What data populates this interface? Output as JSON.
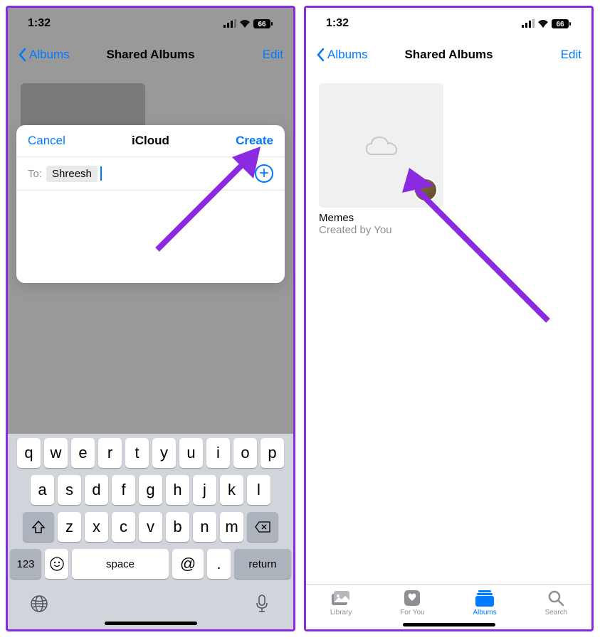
{
  "status": {
    "time": "1:32",
    "battery": "66"
  },
  "nav": {
    "back": "Albums",
    "title": "Shared Albums",
    "edit": "Edit"
  },
  "modal": {
    "cancel": "Cancel",
    "title": "iCloud",
    "create": "Create",
    "to_label": "To:",
    "to_value": "Shreesh"
  },
  "album": {
    "name": "Memes",
    "subtitle": "Created by You"
  },
  "tabs": {
    "library": "Library",
    "foryou": "For You",
    "albums": "Albums",
    "search": "Search"
  },
  "keyboard": {
    "row1": [
      "q",
      "w",
      "e",
      "r",
      "t",
      "y",
      "u",
      "i",
      "o",
      "p"
    ],
    "row2": [
      "a",
      "s",
      "d",
      "f",
      "g",
      "h",
      "j",
      "k",
      "l"
    ],
    "row3": [
      "z",
      "x",
      "c",
      "v",
      "b",
      "n",
      "m"
    ],
    "num": "123",
    "space": "space",
    "at": "@",
    "dot": ".",
    "return": "return"
  }
}
